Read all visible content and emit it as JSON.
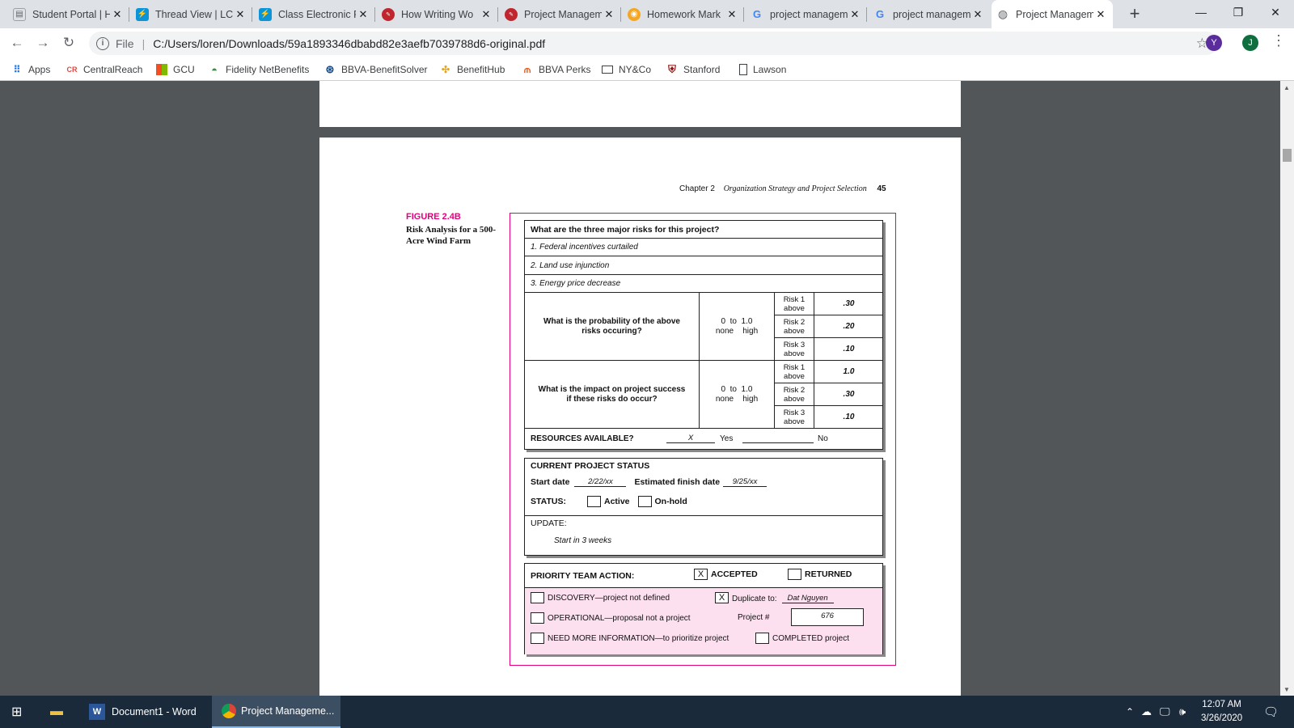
{
  "browser": {
    "tabs": [
      {
        "title": "Student Portal | Ho",
        "favicon": "document-icon",
        "active": false
      },
      {
        "title": "Thread View | LC",
        "favicon": "lightning-icon",
        "active": false
      },
      {
        "title": "Class Electronic F",
        "favicon": "lightning-icon",
        "active": false
      },
      {
        "title": "How Writing Wo",
        "favicon": "pen-icon",
        "active": false
      },
      {
        "title": "Project Managem",
        "favicon": "pen-icon",
        "active": false
      },
      {
        "title": "Homework Mark",
        "favicon": "owl-icon",
        "active": false
      },
      {
        "title": "project managem",
        "favicon": "google-icon",
        "active": false
      },
      {
        "title": "project managem",
        "favicon": "google-icon",
        "active": false
      },
      {
        "title": "Project Managem",
        "favicon": "globe-icon",
        "active": true
      }
    ],
    "address": {
      "scheme": "File",
      "url": "C:/Users/loren/Downloads/59a1893346dbabd82e3aefb7039788d6-original.pdf"
    },
    "profile_initials": [
      "Y",
      "J"
    ],
    "bookmarks": [
      {
        "label": "Apps",
        "icon": "apps-grid-icon"
      },
      {
        "label": "CentralReach",
        "icon": "cr-icon"
      },
      {
        "label": "GCU",
        "icon": "gcu-icon"
      },
      {
        "label": "Fidelity NetBenefits",
        "icon": "fidelity-icon"
      },
      {
        "label": "BBVA-BenefitSolver",
        "icon": "bbva-icon"
      },
      {
        "label": "BenefitHub",
        "icon": "benefithub-icon"
      },
      {
        "label": "BBVA Perks",
        "icon": "perks-icon"
      },
      {
        "label": "NY&Co",
        "icon": "card-icon"
      },
      {
        "label": "Stanford",
        "icon": "shield-icon"
      },
      {
        "label": "Lawson",
        "icon": "doc-icon"
      }
    ]
  },
  "pdf": {
    "running_head": {
      "chapter": "Chapter 2",
      "title": "Organization Strategy and Project Selection",
      "page": "45"
    },
    "figure_label": "FIGURE 2.4B",
    "figure_caption": "Risk Analysis for a 500-Acre Wind Farm",
    "risks": {
      "question": "What are the three major risks for this project?",
      "items": [
        "1.  Federal incentives curtailed",
        "2.  Land use injunction",
        "3.  Energy price decrease"
      ]
    },
    "probability": {
      "question": "What is the probability of the above risks occuring?",
      "scale": "0  to  1.0",
      "scale_ends": "none    high",
      "labels": [
        "Risk 1 above",
        "Risk 2 above",
        "Risk 3 above"
      ],
      "values": [
        ".30",
        ".20",
        ".10"
      ]
    },
    "impact": {
      "question": "What is the impact on project success if these risks do occur?",
      "scale": "0  to  1.0",
      "scale_ends": "none    high",
      "labels": [
        "Risk 1 above",
        "Risk 2 above",
        "Risk 3 above"
      ],
      "values": [
        "1.0",
        ".30",
        ".10"
      ]
    },
    "resources": {
      "label": "RESOURCES AVAILABLE?",
      "mark": "X",
      "yes": "Yes",
      "no": "No"
    },
    "status": {
      "title": "CURRENT PROJECT STATUS",
      "start_label": "Start date",
      "start_value": "2/22/xx",
      "finish_label": "Estimated finish date",
      "finish_value": "9/25/xx",
      "status_label": "STATUS:",
      "active": "Active",
      "onhold": "On-hold",
      "update_label": "UPDATE:",
      "update_text": "Start in 3 weeks"
    },
    "priority": {
      "title": "PRIORITY TEAM ACTION:",
      "accepted": "ACCEPTED",
      "accepted_mark": "X",
      "returned": "RETURNED",
      "discovery": "DISCOVERY—project not defined",
      "duplicate_label": "Duplicate to:",
      "duplicate_mark": "X",
      "duplicate_value": "Dat Nguyen",
      "operational": "OPERATIONAL—proposal not a project",
      "project_num_label": "Project #",
      "project_num": "676",
      "more_info": "NEED MORE INFORMATION—to prioritize project",
      "completed": "COMPLETED project"
    }
  },
  "taskbar": {
    "apps": [
      {
        "label": "Document1 - Word",
        "icon": "word-icon"
      },
      {
        "label": "Project Manageme...",
        "icon": "chrome-icon"
      }
    ],
    "time": "12:07 AM",
    "date": "3/26/2020"
  }
}
